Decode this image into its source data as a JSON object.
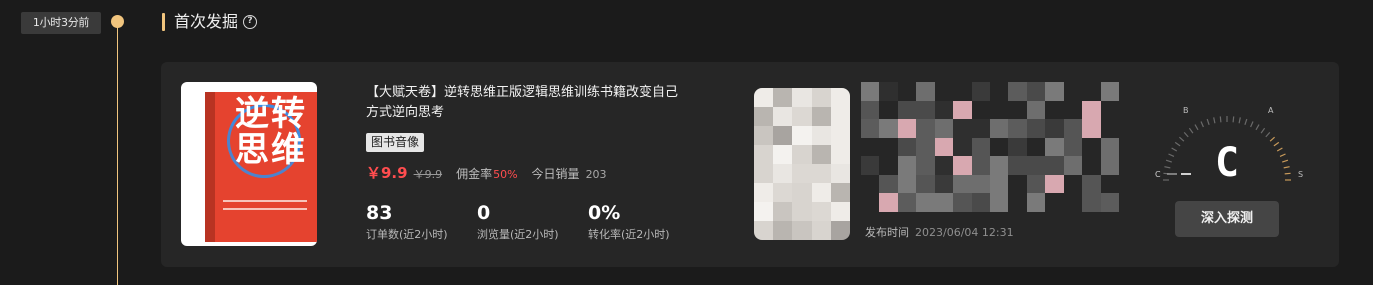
{
  "timeline": {
    "time_label": "1小时3分前"
  },
  "section": {
    "title": "首次发掘",
    "help_icon": "question-circle-icon"
  },
  "product": {
    "title": "【大赋天卷】逆转思维正版逻辑思维训练书籍改变自己方式逆向思考",
    "tag": "图书音像",
    "price": "￥9.9",
    "original_price": "￥9.9",
    "commission_label": "佣金率",
    "commission_rate": "50%",
    "today_sales_label": "今日销量",
    "today_sales": "203",
    "cover": {
      "title": "逆转思维",
      "vertical_text": "逆转思维"
    }
  },
  "stats": [
    {
      "value": "83",
      "label": "订单数(近2小时)"
    },
    {
      "value": "0",
      "label": "浏览量(近2小时)"
    },
    {
      "value": "0%",
      "label": "转化率(近2小时)"
    }
  ],
  "video": {
    "publish_label": "发布时间",
    "publish_time": "2023/06/04 12:31"
  },
  "gauge": {
    "grade": "C",
    "scale_labels": [
      "C",
      "B",
      "A",
      "S"
    ]
  },
  "actions": {
    "deep_detect_label": "深入探测"
  },
  "colors": {
    "accent": "#f1c57e",
    "price": "#ff4d4f",
    "background": "#1b1b1b",
    "card": "#262626"
  }
}
